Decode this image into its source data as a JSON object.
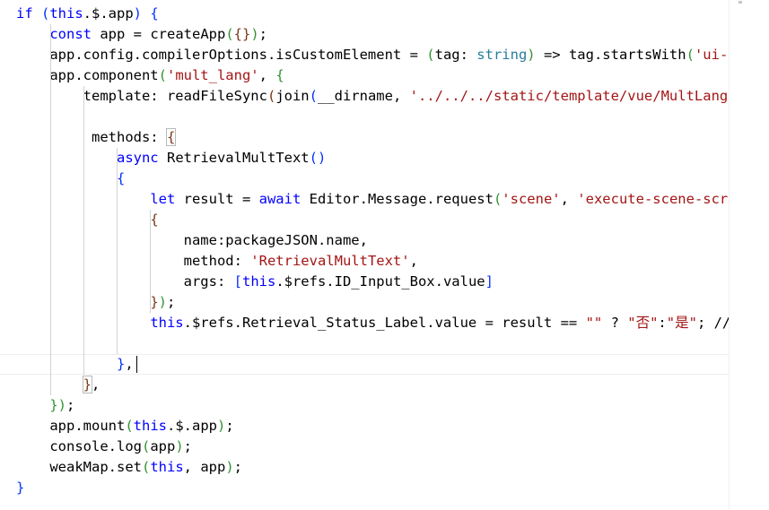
{
  "editor": {
    "lines": [
      [
        {
          "t": "if ",
          "c": "kw"
        },
        {
          "t": "(",
          "c": "bk"
        },
        {
          "t": "this",
          "c": "kw"
        },
        {
          "t": ".$.app",
          "c": ""
        },
        {
          "t": ")",
          "c": "bk"
        },
        {
          "t": " ",
          "c": ""
        },
        {
          "t": "{",
          "c": "bk"
        }
      ],
      [
        {
          "t": "    ",
          "c": ""
        },
        {
          "t": "const",
          "c": "kw"
        },
        {
          "t": " app = createApp",
          "c": ""
        },
        {
          "t": "(",
          "c": "bkv"
        },
        {
          "t": "{}",
          "c": "bkb"
        },
        {
          "t": ")",
          "c": "bkv"
        },
        {
          "t": ";",
          "c": ""
        }
      ],
      [
        {
          "t": "    app.config.compilerOptions.isCustomElement = ",
          "c": ""
        },
        {
          "t": "(",
          "c": "bkv"
        },
        {
          "t": "tag: ",
          "c": ""
        },
        {
          "t": "string",
          "c": "ty"
        },
        {
          "t": ")",
          "c": "bkv"
        },
        {
          "t": " => tag.startsWith",
          "c": ""
        },
        {
          "t": "(",
          "c": "bkv"
        },
        {
          "t": "'ui-'",
          "c": "str"
        }
      ],
      [
        {
          "t": "    app.component",
          "c": ""
        },
        {
          "t": "(",
          "c": "bkv"
        },
        {
          "t": "'mult_lang'",
          "c": "str"
        },
        {
          "t": ", ",
          "c": ""
        },
        {
          "t": "{",
          "c": "bkv"
        }
      ],
      [
        {
          "t": "        template: readFileSync",
          "c": ""
        },
        {
          "t": "(",
          "c": "bkb"
        },
        {
          "t": "join",
          "c": ""
        },
        {
          "t": "(",
          "c": "bk"
        },
        {
          "t": "__dirname, ",
          "c": ""
        },
        {
          "t": "'../../../static/template/vue/MultLang.h",
          "c": "str"
        }
      ],
      [
        {
          "t": "",
          "c": ""
        }
      ],
      [
        {
          "t": "         methods: ",
          "c": ""
        },
        {
          "t": "{",
          "c": "bkb hl"
        }
      ],
      [
        {
          "t": "            ",
          "c": ""
        },
        {
          "t": "async",
          "c": "kw"
        },
        {
          "t": " RetrievalMultText",
          "c": ""
        },
        {
          "t": "()",
          "c": "bk"
        }
      ],
      [
        {
          "t": "            ",
          "c": ""
        },
        {
          "t": "{",
          "c": "bk"
        }
      ],
      [
        {
          "t": "                ",
          "c": ""
        },
        {
          "t": "let",
          "c": "kw"
        },
        {
          "t": " result = ",
          "c": ""
        },
        {
          "t": "await",
          "c": "kw"
        },
        {
          "t": " Editor.Message.request",
          "c": ""
        },
        {
          "t": "(",
          "c": "bkv"
        },
        {
          "t": "'scene'",
          "c": "str"
        },
        {
          "t": ", ",
          "c": ""
        },
        {
          "t": "'execute-scene-scrip",
          "c": "str"
        }
      ],
      [
        {
          "t": "                ",
          "c": ""
        },
        {
          "t": "{",
          "c": "bkb"
        }
      ],
      [
        {
          "t": "                    name:packageJSON.name,",
          "c": ""
        }
      ],
      [
        {
          "t": "                    method: ",
          "c": ""
        },
        {
          "t": "'RetrievalMultText'",
          "c": "str"
        },
        {
          "t": ",",
          "c": ""
        }
      ],
      [
        {
          "t": "                    args: ",
          "c": ""
        },
        {
          "t": "[",
          "c": "bk"
        },
        {
          "t": "this",
          "c": "kw"
        },
        {
          "t": ".$refs.ID_Input_Box.value",
          "c": ""
        },
        {
          "t": "]",
          "c": "bk"
        }
      ],
      [
        {
          "t": "                ",
          "c": ""
        },
        {
          "t": "}",
          "c": "bkb"
        },
        {
          "t": ")",
          "c": "bkv"
        },
        {
          "t": ";",
          "c": ""
        }
      ],
      [
        {
          "t": "                ",
          "c": ""
        },
        {
          "t": "this",
          "c": "kw"
        },
        {
          "t": ".$refs.Retrieval_Status_Label.value = result == ",
          "c": ""
        },
        {
          "t": "\"\"",
          "c": "str"
        },
        {
          "t": " ? ",
          "c": ""
        },
        {
          "t": "\"否\"",
          "c": "str"
        },
        {
          "t": ":",
          "c": ""
        },
        {
          "t": "\"是\"",
          "c": "str"
        },
        {
          "t": "; //i",
          "c": ""
        }
      ],
      [
        {
          "t": "",
          "c": ""
        }
      ],
      [
        {
          "t": "            ",
          "c": ""
        },
        {
          "t": "}",
          "c": "bk"
        },
        {
          "t": ",",
          "c": ""
        }
      ],
      [
        {
          "t": "        ",
          "c": ""
        },
        {
          "t": "}",
          "c": "bkb hl"
        },
        {
          "t": ",",
          "c": ""
        }
      ],
      [
        {
          "t": "    ",
          "c": ""
        },
        {
          "t": "}",
          "c": "bkv"
        },
        {
          "t": ")",
          "c": "bkv"
        },
        {
          "t": ";",
          "c": ""
        }
      ],
      [
        {
          "t": "    app.mount",
          "c": ""
        },
        {
          "t": "(",
          "c": "bkv"
        },
        {
          "t": "this",
          "c": "kw"
        },
        {
          "t": ".$.app",
          "c": ""
        },
        {
          "t": ")",
          "c": "bkv"
        },
        {
          "t": ";",
          "c": ""
        }
      ],
      [
        {
          "t": "    console.log",
          "c": ""
        },
        {
          "t": "(",
          "c": "bkv"
        },
        {
          "t": "app",
          "c": ""
        },
        {
          "t": ")",
          "c": "bkv"
        },
        {
          "t": ";",
          "c": ""
        }
      ],
      [
        {
          "t": "    weakMap.set",
          "c": ""
        },
        {
          "t": "(",
          "c": "bkv"
        },
        {
          "t": "this",
          "c": "kw"
        },
        {
          "t": ", app",
          "c": ""
        },
        {
          "t": ")",
          "c": "bkv"
        },
        {
          "t": ";",
          "c": ""
        }
      ],
      [
        {
          "t": "}",
          "c": "bk"
        }
      ]
    ],
    "current_line": 18,
    "colors": {
      "keyword": "#0000ff",
      "string": "#a31515",
      "type": "#267f99",
      "bracket_level1": "#0431fa",
      "bracket_level2": "#319331",
      "bracket_level3": "#7b3814",
      "indent_guide": "#d3d3d3",
      "background": "#ffffff"
    }
  }
}
